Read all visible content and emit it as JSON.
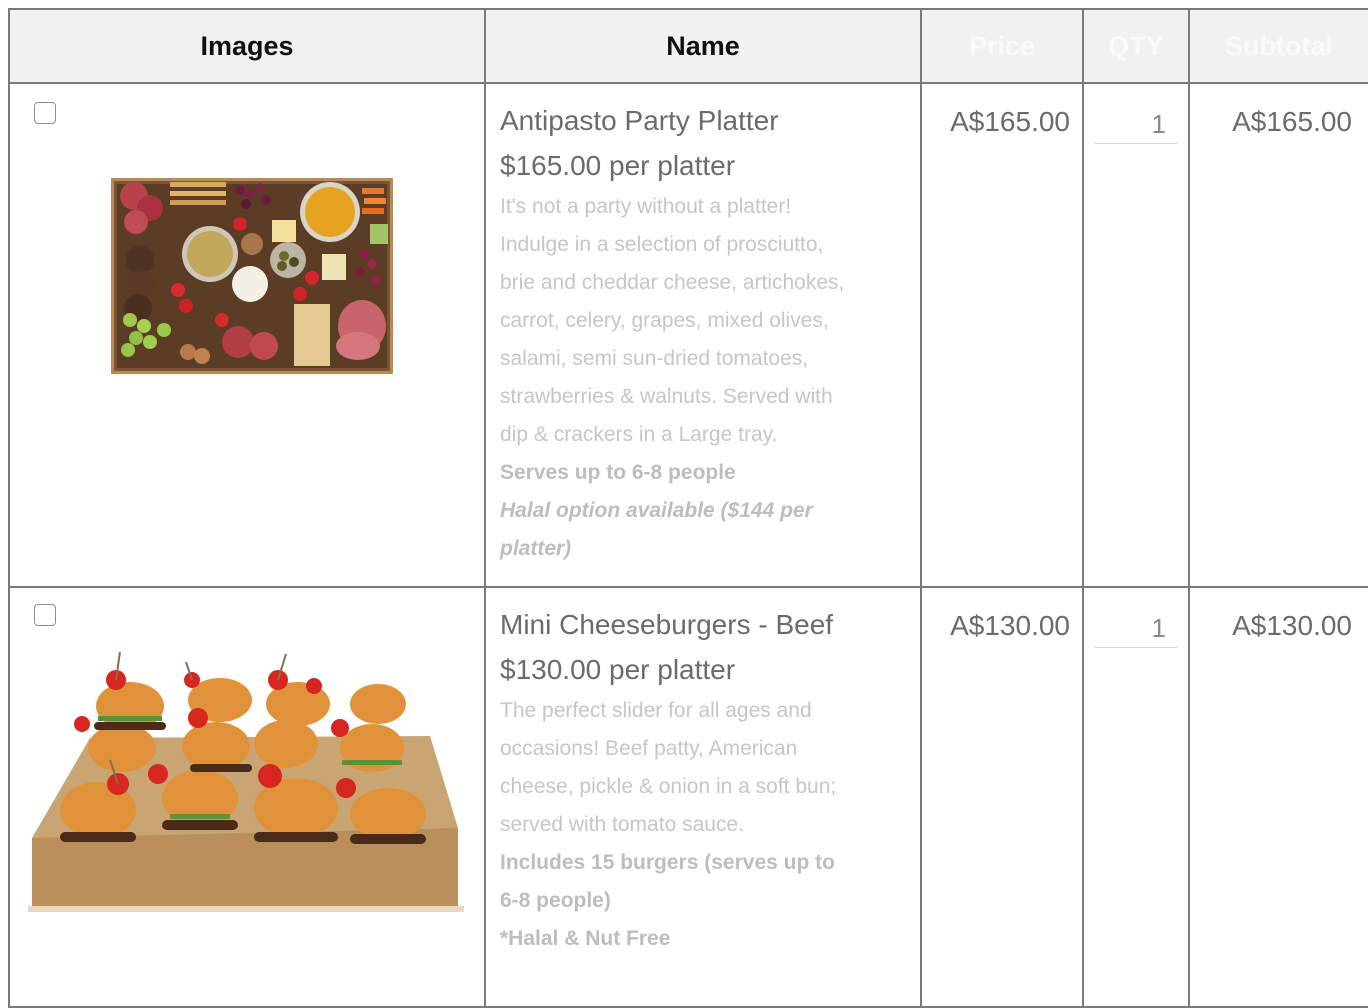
{
  "table": {
    "headers": {
      "images": "Images",
      "name": "Name",
      "price": "Price",
      "qty": "QTY",
      "subtotal": "Subtotal"
    }
  },
  "rows": [
    {
      "name": "Antipasto Party Platter",
      "unit_price": "$165.00 per platter",
      "description": [
        "It's not a party without a platter!",
        "Indulge in a selection of prosciutto,",
        "brie and cheddar cheese, artichokes,",
        "carrot, celery, grapes, mixed olives,",
        "salami, semi sun-dried tomatoes,",
        "strawberries & walnuts. Served with",
        "dip & crackers in a Large tray."
      ],
      "serves": "Serves up to 6-8 people",
      "halal": [
        "Halal option available ($144 per",
        "platter)"
      ],
      "price": "A$165.00",
      "qty": "1",
      "subtotal": "A$165.00",
      "image_icon": "antipasto-platter-photo"
    },
    {
      "name": "Mini Cheeseburgers - Beef",
      "unit_price": "$130.00 per platter",
      "description": [
        "The perfect slider for all ages and",
        "occasions! Beef patty, American",
        "cheese, pickle & onion in a soft bun;",
        "served with tomato sauce."
      ],
      "includes": [
        "Includes 15 burgers (serves up to",
        "6-8 people)"
      ],
      "note": "*Halal & Nut Free",
      "price": "A$130.00",
      "qty": "1",
      "subtotal": "A$130.00",
      "image_icon": "cheeseburger-platter-photo"
    }
  ],
  "colors": {
    "header_bg": "#f1f1f1",
    "border": "#7a7a7a",
    "name_text": "#6b6b6b",
    "desc_text": "#c6c6c6"
  }
}
